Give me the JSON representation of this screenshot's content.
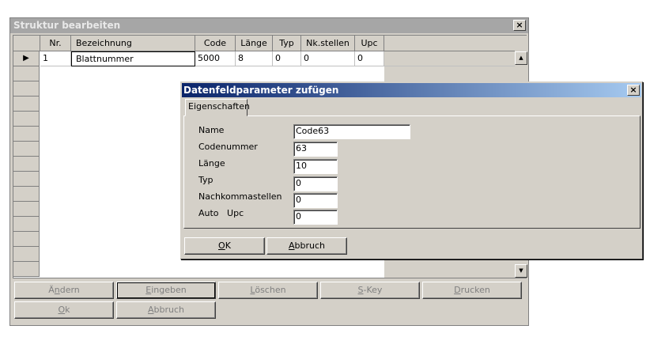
{
  "main_window": {
    "title": "Struktur bearbeiten",
    "close": "×"
  },
  "grid": {
    "columns": [
      "Nr.",
      "Bezeichnung",
      "Code",
      "Länge",
      "Typ",
      "Nk.stellen",
      "Upc"
    ],
    "rows": [
      {
        "nr": "1",
        "bezeichnung": "Blattnummer",
        "code": "5000",
        "laenge": "8",
        "typ": "0",
        "nkstellen": "0",
        "upc": "0"
      }
    ],
    "row_indicator": "▶",
    "scroll_up": "▲",
    "scroll_down": "▼"
  },
  "buttons_row1": [
    {
      "pre": "Ä",
      "ul": "n",
      "post": "dern"
    },
    {
      "pre": "",
      "ul": "E",
      "post": "ingeben"
    },
    {
      "pre": "",
      "ul": "L",
      "post": "öschen"
    },
    {
      "pre": "",
      "ul": "S",
      "post": "-Key"
    },
    {
      "pre": "",
      "ul": "D",
      "post": "rucken"
    }
  ],
  "buttons_row2": [
    {
      "pre": "",
      "ul": "O",
      "post": "k"
    },
    {
      "pre": "",
      "ul": "A",
      "post": "bbruch"
    }
  ],
  "dialog": {
    "title": "Datenfeldparameter zufügen",
    "close": "×",
    "tab": "Eigenschaften",
    "fields": [
      {
        "label": "Name",
        "value": "Code63"
      },
      {
        "label": "Codenummer",
        "value": "63"
      },
      {
        "label": "Länge",
        "value": "10"
      },
      {
        "label": "Typ",
        "value": "0"
      },
      {
        "label": "Nachkommastellen",
        "value": "0"
      },
      {
        "label": "Auto   Upc",
        "value": "0"
      }
    ],
    "ok_ul": "O",
    "ok_post": "K",
    "cancel_ul": "A",
    "cancel_post": "bbruch"
  }
}
